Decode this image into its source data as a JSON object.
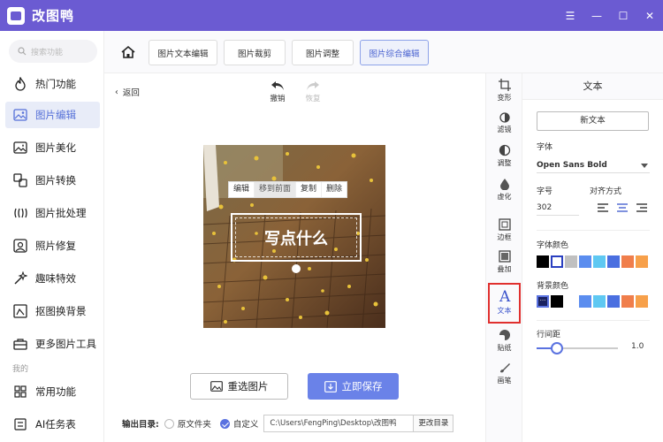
{
  "app": {
    "title": "改图鸭",
    "window_controls": {
      "menu": "☰",
      "minimize": "—",
      "maximize": "☐",
      "close": "✕"
    }
  },
  "sidebar": {
    "search_placeholder": "搜索功能",
    "section_label": "我的",
    "items": [
      {
        "label": "热门功能",
        "icon": "fire-icon",
        "active": false
      },
      {
        "label": "图片编辑",
        "icon": "image-edit-icon",
        "active": true
      },
      {
        "label": "图片美化",
        "icon": "image-beautify-icon",
        "active": false
      },
      {
        "label": "图片转换",
        "icon": "convert-icon",
        "active": false
      },
      {
        "label": "图片批处理",
        "icon": "batch-icon",
        "active": false
      },
      {
        "label": "照片修复",
        "icon": "photo-repair-icon",
        "active": false
      },
      {
        "label": "趣味特效",
        "icon": "magic-effect-icon",
        "active": false
      },
      {
        "label": "抠图换背景",
        "icon": "cutout-icon",
        "active": false
      },
      {
        "label": "更多图片工具",
        "icon": "toolbox-icon",
        "active": false
      }
    ],
    "my_items": [
      {
        "label": "常用功能",
        "icon": "grid-icon"
      },
      {
        "label": "AI任务表",
        "icon": "ai-task-icon"
      }
    ]
  },
  "tabs": [
    {
      "label": "图片文本编辑",
      "active": false
    },
    {
      "label": "图片裁剪",
      "active": false
    },
    {
      "label": "图片调整",
      "active": false
    },
    {
      "label": "图片综合编辑",
      "active": true
    }
  ],
  "canvas": {
    "back_label": "返回",
    "undo_label": "撤销",
    "redo_label": "恢复",
    "edit_menu": [
      "编辑",
      "移到前面",
      "复制",
      "删除"
    ],
    "text_placeholder": "写点什么",
    "reselect_label": "重选图片",
    "save_label": "立即保存",
    "output": {
      "label": "输出目录:",
      "option_original": "原文件夹",
      "option_custom": "自定义",
      "selected": "自定义",
      "path": "C:\\Users\\FengPing\\Desktop\\改图鸭",
      "change_dir_label": "更改目录"
    }
  },
  "tools": [
    {
      "label": "变形",
      "icon": "crop-icon",
      "active": false
    },
    {
      "label": "滤镜",
      "icon": "filter-icon",
      "active": false
    },
    {
      "label": "调整",
      "icon": "adjust-icon",
      "active": false
    },
    {
      "label": "虚化",
      "icon": "blur-drop-icon",
      "active": false
    },
    {
      "label": "边框",
      "icon": "border-icon",
      "active": false
    },
    {
      "label": "叠加",
      "icon": "overlay-icon",
      "active": false
    },
    {
      "label": "文本",
      "icon": "text-icon",
      "active": true
    },
    {
      "label": "贴纸",
      "icon": "sticker-icon",
      "active": false
    },
    {
      "label": "画笔",
      "icon": "brush-icon",
      "active": false
    }
  ],
  "panel": {
    "title": "文本",
    "new_text_label": "新文本",
    "font_label": "字体",
    "font_value": "Open Sans Bold",
    "size_label": "字号",
    "size_value": "302",
    "align_label": "对齐方式",
    "align_selected": "center",
    "font_color_label": "字体颜色",
    "font_colors": [
      "#000000",
      "#ffffff",
      "#c0c0c0",
      "#5b8def",
      "#5ec8f2",
      "#4a6fe0",
      "#f07e4b",
      "#f7a04a"
    ],
    "font_color_selected": "#ffffff",
    "bg_color_label": "背景颜色",
    "bg_colors": [
      "#000000",
      "#ffffff",
      "#5b8def",
      "#5ec8f2",
      "#4a6fe0",
      "#f07e4b",
      "#f7a04a"
    ],
    "line_height_label": "行间距",
    "line_height_value": "1.0",
    "line_height_fraction": 0.25
  },
  "colors": {
    "accent": "#6b5bd2",
    "primary_button": "#6a82e8",
    "highlight_border": "#e0302e"
  }
}
